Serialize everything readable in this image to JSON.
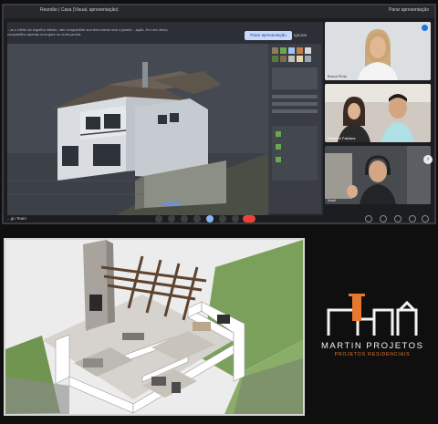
{
  "meeting": {
    "title": "Reunião | Casa (Visual, apresentação)",
    "top_right": "Parar apresentação",
    "banner_text": "...ar o efeito de espelho infinito, não compartilhe sua tela inteira nem a janela ...ação. Em vez disso, compartilhe apenas uma guia ou outra janela.",
    "present_button": "Parar apresentação",
    "ignore_button": "Ignorar",
    "footer_name": "...gn Team",
    "participants": [
      {
        "name": "Bruna Pinto"
      },
      {
        "name": "Rafael e Fabiana"
      },
      {
        "name": "Você"
      }
    ],
    "controls": [
      "mic-icon",
      "camera-icon",
      "captions-icon",
      "raise-hand-icon",
      "present-icon",
      "more-icon",
      "end-call-icon"
    ],
    "end_call_color": "#ea4335",
    "accent": "#1a73e8"
  },
  "brand": {
    "name": "MARTIN PROJETOS",
    "tagline": "PROJETOS RESIDENCIAIS",
    "accent": "#e8772e"
  }
}
